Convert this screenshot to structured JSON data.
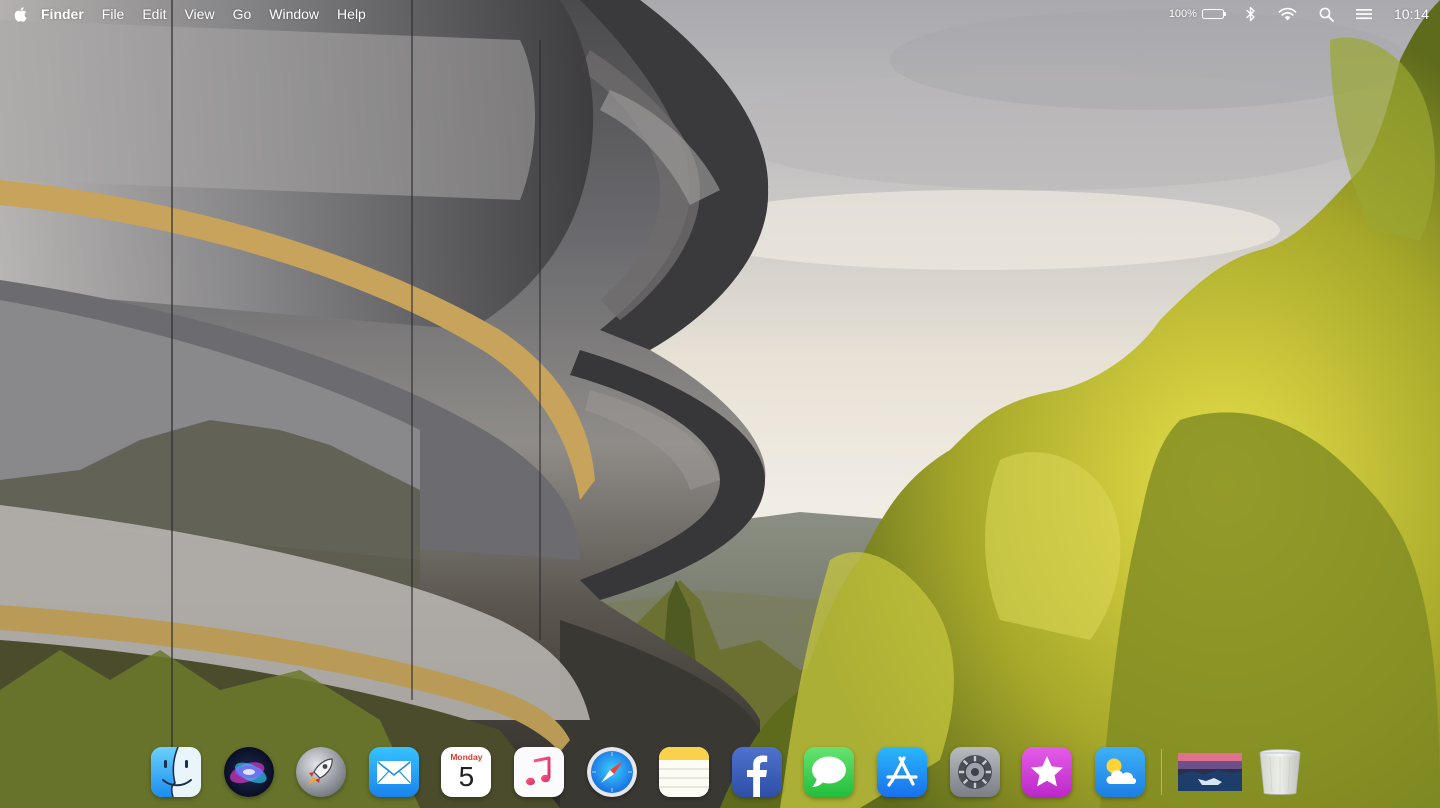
{
  "menubar": {
    "apple_icon": "apple-logo-icon",
    "app_name": "Finder",
    "menus": [
      "File",
      "Edit",
      "View",
      "Go",
      "Window",
      "Help"
    ],
    "battery_percent": "100%",
    "battery_level": 1.0,
    "status_icons": [
      "battery-icon",
      "bluetooth-icon",
      "wifi-icon",
      "search-icon",
      "menu-list-icon"
    ],
    "clock": "10:14"
  },
  "dock": {
    "items": [
      {
        "name": "finder",
        "icon": "finder-face-icon"
      },
      {
        "name": "siri",
        "icon": "siri-orb-icon"
      },
      {
        "name": "launchpad",
        "icon": "rocket-icon"
      },
      {
        "name": "mail",
        "icon": "envelope-icon"
      },
      {
        "name": "calendar",
        "icon": "calendar-icon",
        "month": "Monday",
        "day": "5"
      },
      {
        "name": "music",
        "icon": "music-note-icon"
      },
      {
        "name": "safari",
        "icon": "compass-icon"
      },
      {
        "name": "notes",
        "icon": "notes-icon"
      },
      {
        "name": "facebook",
        "icon": "facebook-f-icon"
      },
      {
        "name": "messages",
        "icon": "speech-bubble-icon"
      },
      {
        "name": "app-store",
        "icon": "app-store-a-icon"
      },
      {
        "name": "system-preferences",
        "icon": "gear-icon"
      },
      {
        "name": "itunes-store",
        "icon": "star-icon"
      },
      {
        "name": "weather",
        "icon": "cloud-sun-icon"
      },
      {
        "name": "wallpaper-folder",
        "icon": "image-stack-icon"
      },
      {
        "name": "trash",
        "icon": "trash-icon"
      }
    ]
  },
  "colors": {
    "menubar_text": "#ffffff",
    "calendar_red": "#e2382b",
    "mail_blue": "#1e9bf0",
    "messages_green": "#3ccf4e",
    "itunes_magenta": "#d13bd8",
    "facebook_blue": "#3b5db8"
  }
}
